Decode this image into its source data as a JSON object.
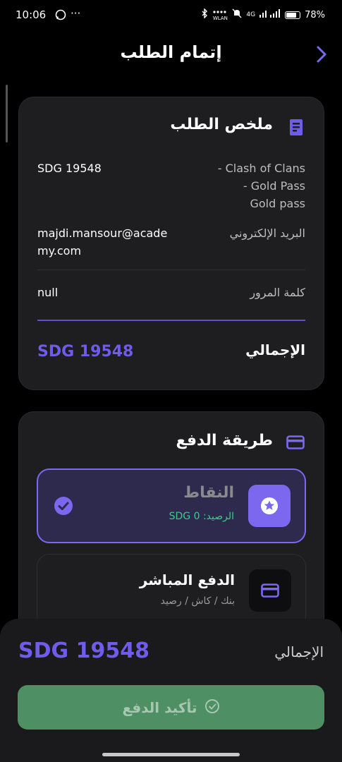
{
  "status_bar": {
    "time": "10:06",
    "left_dots": "···",
    "wlan": "WLAN",
    "network": "4G",
    "battery": "78%"
  },
  "header": {
    "title": "إتمام الطلب"
  },
  "summary": {
    "title": "ملخص الطلب",
    "product_lines": [
      "Clash of Clans -",
      "Gold Pass -",
      "Gold pass"
    ],
    "price": "SDG 19548",
    "email_label": "البريد الإلكتروني",
    "email_lines": [
      "majdi.mansour@acade",
      "my.com"
    ],
    "password_label": "كلمة المرور",
    "password_value": "null",
    "total_label": "الإجمالي",
    "total_value": "SDG 19548"
  },
  "payment": {
    "title": "طريقة الدفع",
    "points": {
      "title": "النقاط",
      "balance_label": "الرصيد:",
      "balance_value": "SDG 0"
    },
    "direct": {
      "title": "الدفع المباشر",
      "subtitle": "بنك / كاش / رصيد"
    }
  },
  "footer": {
    "total_label": "الإجمالي",
    "total_value": "SDG 19548",
    "confirm_label": "تأكيد الدفع"
  },
  "colors": {
    "accent": "#7b68ee",
    "card_bg": "#1e1e21",
    "confirm_bg": "#4e8f64",
    "balance_green": "#3fc98a"
  },
  "icons": {
    "back": "chevron-right-icon",
    "summary": "receipt-icon",
    "payment": "credit-card-icon",
    "points": "star-badge-icon",
    "selected": "check-circle-icon",
    "direct": "credit-card-icon",
    "confirm": "check-circle-outline-icon"
  }
}
